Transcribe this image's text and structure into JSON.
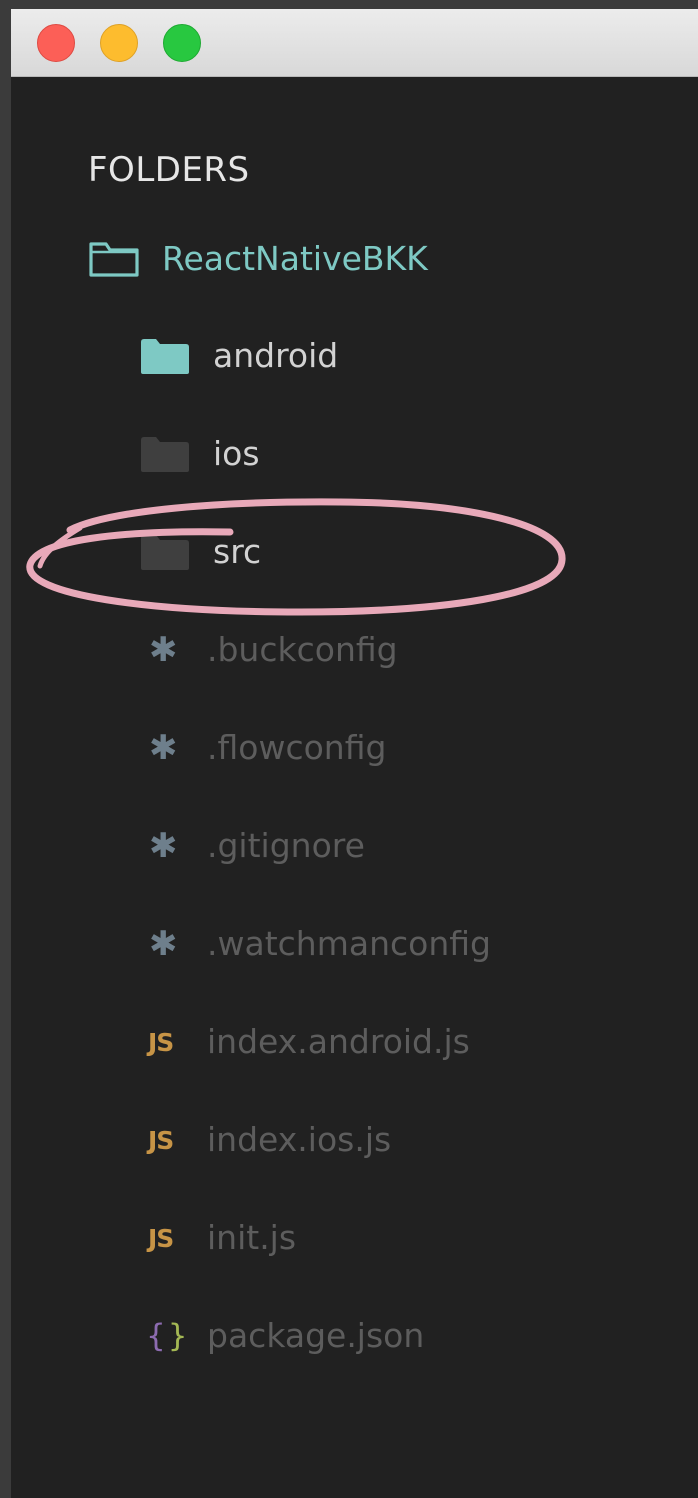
{
  "window": {
    "controls": [
      "close",
      "minimize",
      "maximize"
    ],
    "colors": {
      "close": "#fc5f57",
      "minimize": "#fdbc2e",
      "maximize": "#28c840"
    }
  },
  "sidebar": {
    "heading": "FOLDERS",
    "root": {
      "label": "ReactNativeBKK",
      "icon": "folder-open-outline-icon",
      "color": "#7ec9c4"
    },
    "items": [
      {
        "label": "android",
        "icon": "folder-icon",
        "type": "folder",
        "color": "#d2d2d2",
        "icon_color": "#7ec9c4"
      },
      {
        "label": "ios",
        "icon": "folder-icon",
        "type": "folder",
        "color": "#d2d2d2",
        "icon_color": "#3f3f3f"
      },
      {
        "label": "src",
        "icon": "folder-icon",
        "type": "folder",
        "color": "#d2d2d2",
        "icon_color": "#3f3f3f",
        "annotated": true
      },
      {
        "label": ".buckconfig",
        "icon": "asterisk-icon",
        "type": "file",
        "color": "#5d5d5d"
      },
      {
        "label": ".flowconfig",
        "icon": "asterisk-icon",
        "type": "file",
        "color": "#5d5d5d"
      },
      {
        "label": ".gitignore",
        "icon": "asterisk-icon",
        "type": "file",
        "color": "#5d5d5d"
      },
      {
        "label": ".watchmanconfig",
        "icon": "asterisk-icon",
        "type": "file",
        "color": "#5d5d5d"
      },
      {
        "label": "index.android.js",
        "icon": "js-icon",
        "type": "file",
        "color": "#5d5d5d"
      },
      {
        "label": "index.ios.js",
        "icon": "js-icon",
        "type": "file",
        "color": "#5d5d5d"
      },
      {
        "label": "init.js",
        "icon": "js-icon",
        "type": "file",
        "color": "#5d5d5d"
      },
      {
        "label": "package.json",
        "icon": "json-braces-icon",
        "type": "file",
        "color": "#5d5d5d"
      }
    ],
    "icon_text": {
      "js": "JS",
      "braces_open": "{",
      "braces_close": "}",
      "asterisk": "✱"
    }
  },
  "annotation": {
    "shape": "hand-drawn-ellipse",
    "color": "#e8a9b9"
  }
}
